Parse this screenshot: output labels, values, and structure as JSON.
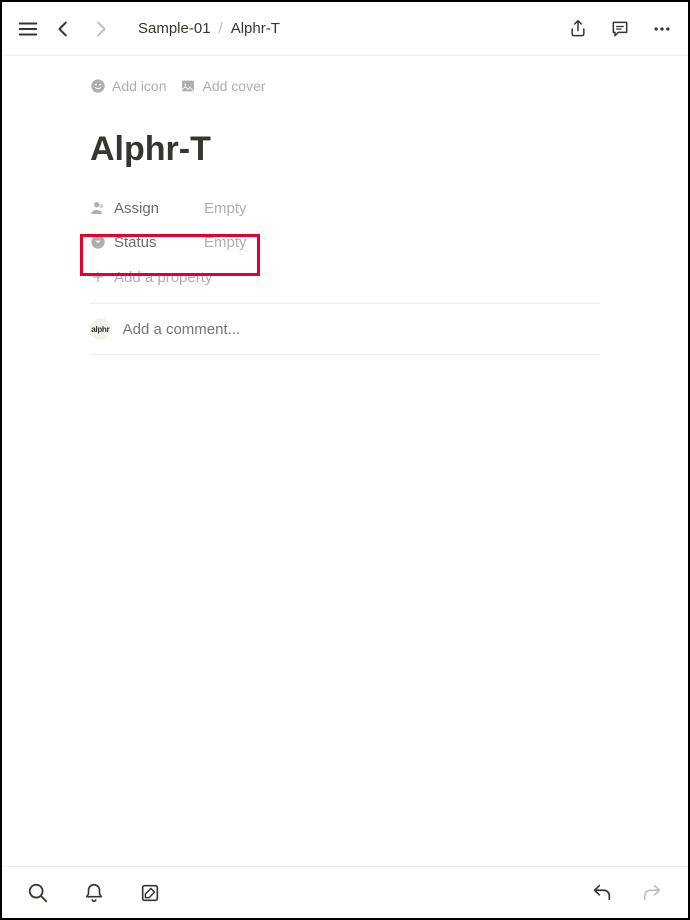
{
  "breadcrumb": {
    "parent": "Sample-01",
    "current": "Alphr-T"
  },
  "meta": {
    "add_icon_label": "Add icon",
    "add_cover_label": "Add cover"
  },
  "page": {
    "title": "Alphr-T"
  },
  "properties": [
    {
      "label": "Assign",
      "value": "Empty"
    },
    {
      "label": "Status",
      "value": "Empty"
    }
  ],
  "add_property_label": "Add a property",
  "comment": {
    "placeholder": "Add a comment...",
    "avatar_text": "alphr"
  }
}
